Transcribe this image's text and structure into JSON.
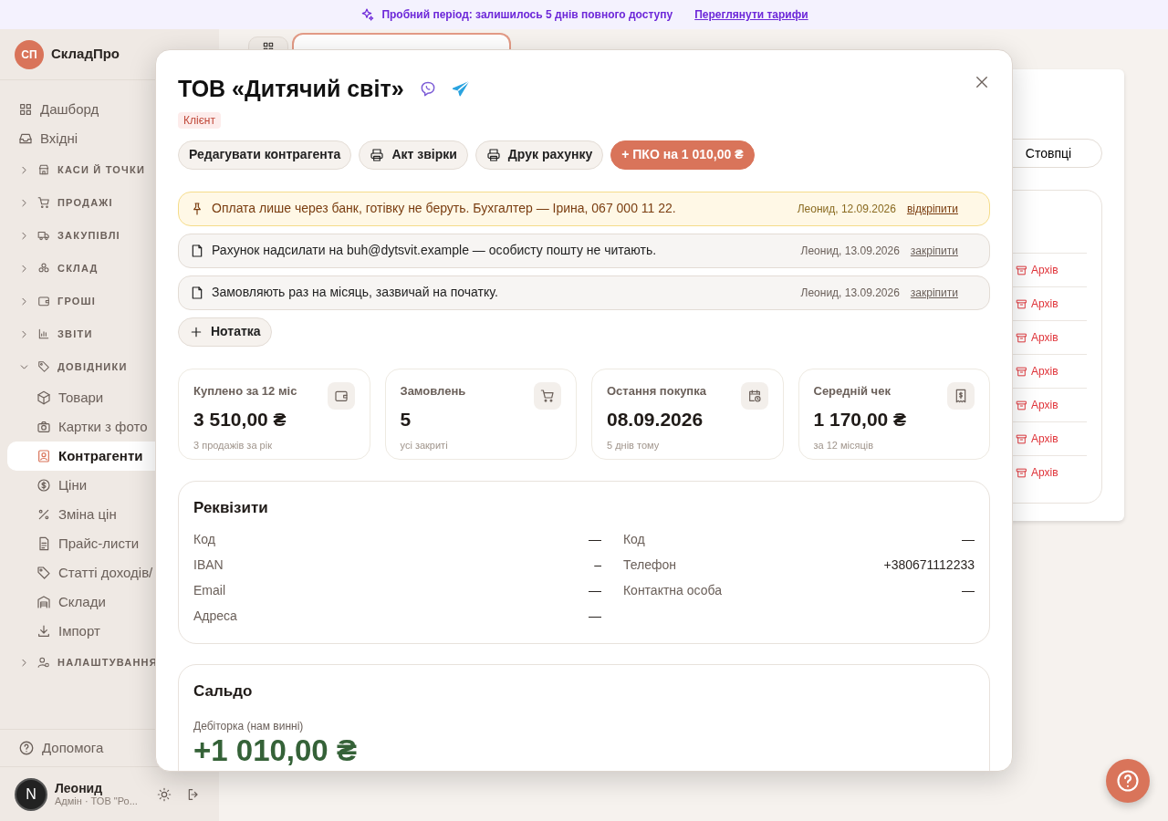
{
  "banner": {
    "text": "Пробний період: залишилось **5** днів повного доступу",
    "link": "Переглянути тарифи"
  },
  "sidebar": {
    "logo": "СП",
    "brand": "СкладПро",
    "items": [
      {
        "kind": "link",
        "label": "Дашборд",
        "selected": false
      },
      {
        "kind": "link",
        "label": "Вхідні",
        "selected": false
      },
      {
        "kind": "group",
        "label": "КАСИ Й ТОЧКИ",
        "expanded": false
      },
      {
        "kind": "group",
        "label": "ПРОДАЖІ",
        "expanded": false
      },
      {
        "kind": "group",
        "label": "ЗАКУПІВЛІ",
        "expanded": false
      },
      {
        "kind": "group",
        "label": "СКЛАД",
        "expanded": false
      },
      {
        "kind": "group",
        "label": "ГРОШІ",
        "expanded": false
      },
      {
        "kind": "group",
        "label": "ЗВІТИ",
        "expanded": false
      },
      {
        "kind": "group",
        "label": "ДОВІДНИКИ",
        "expanded": true,
        "children": [
          {
            "label": "Товари",
            "selected": false
          },
          {
            "label": "Картки з фото",
            "selected": false
          },
          {
            "label": "Контрагенти",
            "selected": true
          },
          {
            "label": "Ціни",
            "selected": false
          },
          {
            "label": "Зміна цін",
            "selected": false
          },
          {
            "label": "Прайс-листи",
            "selected": false
          },
          {
            "label": "Статті доходів/",
            "selected": false
          },
          {
            "label": "Склади",
            "selected": false
          },
          {
            "label": "Імпорт",
            "selected": false
          }
        ]
      },
      {
        "kind": "group",
        "label": "НАЛАШТУВАННЯ",
        "expanded": false
      }
    ],
    "help": "Допомога",
    "user": {
      "avatar": "N",
      "name": "Леонид",
      "role": "Адмін · ТОВ \"Ро..."
    }
  },
  "background": {
    "columns_button": "Стовпці",
    "rows": [
      {
        "action": "Архів"
      },
      {
        "action": "Архів"
      },
      {
        "action": "Архів"
      },
      {
        "action": "Архів"
      },
      {
        "action": "Архів"
      },
      {
        "action": "Архів"
      },
      {
        "action": "Архів"
      }
    ]
  },
  "modal": {
    "title": "ТОВ «Дитячий світ»",
    "badge": "Клієнт",
    "buttons": [
      {
        "kind": "plain",
        "label": "Редагувати контрагента"
      },
      {
        "kind": "print",
        "label": "Акт звірки"
      },
      {
        "kind": "print",
        "label": "Друк рахунку"
      },
      {
        "kind": "primary",
        "label": "+ ПКО на 1 010,00 ₴"
      }
    ],
    "notes": [
      {
        "pinned": true,
        "text": "Оплата лише через банк, готівку не беруть. Бухгалтер — Ірина, 067 000 11 22.",
        "meta": "Леонид, 12.09.2026",
        "action": "відкріпити"
      },
      {
        "pinned": false,
        "text": "Рахунок надсилати на buh@dytsvit.example — особисту пошту не читають.",
        "meta": "Леонид, 13.09.2026",
        "action": "закріпити"
      },
      {
        "pinned": false,
        "text": "Замовляють раз на місяць, зазвичай на початку.",
        "meta": "Леонид, 13.09.2026",
        "action": "закріпити"
      }
    ],
    "add_note": "Нотатка",
    "stats": [
      {
        "kind": "wallet",
        "label": "Куплено за 12 міс",
        "value": "3 510,00 ₴",
        "sub": "3 продажів за рік"
      },
      {
        "kind": "cart",
        "label": "Замовлень",
        "value": "5",
        "sub": "усі закриті"
      },
      {
        "kind": "calendar",
        "label": "Остання покупка",
        "value": "08.09.2026",
        "sub": "5 днів тому"
      },
      {
        "kind": "receipt",
        "label": "Середній чек",
        "value": "1 170,00 ₴",
        "sub": "за 12 місяців"
      }
    ],
    "requisites": {
      "title": "Реквізити",
      "left": [
        {
          "label": "Код",
          "value": "—"
        },
        {
          "label": "IBAN",
          "value": "–"
        },
        {
          "label": "Email",
          "value": "—"
        },
        {
          "label": "Адреса",
          "value": "—"
        }
      ],
      "right": [
        {
          "label": "Код",
          "value": "—"
        },
        {
          "label": "Телефон",
          "value": "+380671112233"
        },
        {
          "label": "Контактна особа",
          "value": "—"
        }
      ]
    },
    "balance": {
      "title": "Сальдо",
      "label": "Дебіторка (нам винні)",
      "value": "+1 010,00 ₴"
    }
  }
}
